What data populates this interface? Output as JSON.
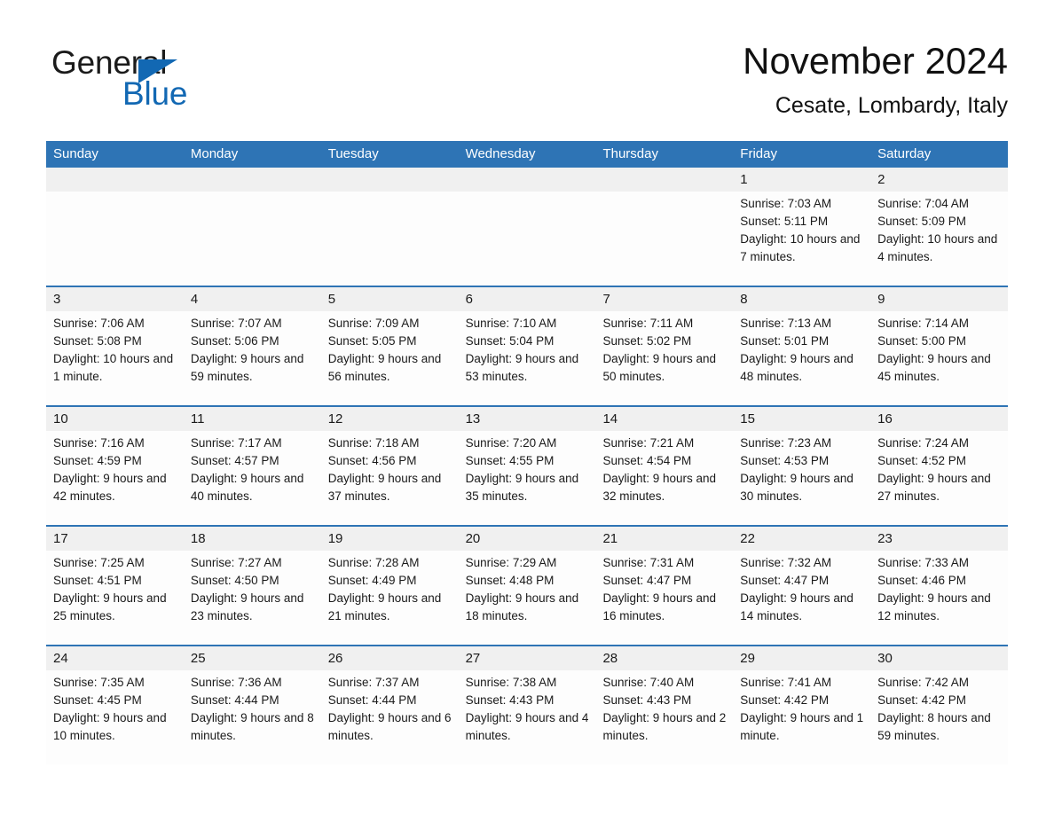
{
  "brand": {
    "name_part1": "General",
    "name_part2": "Blue",
    "accent_color": "#1268b3"
  },
  "header": {
    "month_title": "November 2024",
    "location": "Cesate, Lombardy, Italy",
    "header_bg_color": "#2e74b5"
  },
  "weekdays": [
    "Sunday",
    "Monday",
    "Tuesday",
    "Wednesday",
    "Thursday",
    "Friday",
    "Saturday"
  ],
  "weeks": [
    [
      {
        "day": "",
        "sunrise": "",
        "sunset": "",
        "daylight": "",
        "empty": true
      },
      {
        "day": "",
        "sunrise": "",
        "sunset": "",
        "daylight": "",
        "empty": true
      },
      {
        "day": "",
        "sunrise": "",
        "sunset": "",
        "daylight": "",
        "empty": true
      },
      {
        "day": "",
        "sunrise": "",
        "sunset": "",
        "daylight": "",
        "empty": true
      },
      {
        "day": "",
        "sunrise": "",
        "sunset": "",
        "daylight": "",
        "empty": true
      },
      {
        "day": "1",
        "sunrise": "Sunrise: 7:03 AM",
        "sunset": "Sunset: 5:11 PM",
        "daylight": "Daylight: 10 hours and 7 minutes."
      },
      {
        "day": "2",
        "sunrise": "Sunrise: 7:04 AM",
        "sunset": "Sunset: 5:09 PM",
        "daylight": "Daylight: 10 hours and 4 minutes."
      }
    ],
    [
      {
        "day": "3",
        "sunrise": "Sunrise: 7:06 AM",
        "sunset": "Sunset: 5:08 PM",
        "daylight": "Daylight: 10 hours and 1 minute."
      },
      {
        "day": "4",
        "sunrise": "Sunrise: 7:07 AM",
        "sunset": "Sunset: 5:06 PM",
        "daylight": "Daylight: 9 hours and 59 minutes."
      },
      {
        "day": "5",
        "sunrise": "Sunrise: 7:09 AM",
        "sunset": "Sunset: 5:05 PM",
        "daylight": "Daylight: 9 hours and 56 minutes."
      },
      {
        "day": "6",
        "sunrise": "Sunrise: 7:10 AM",
        "sunset": "Sunset: 5:04 PM",
        "daylight": "Daylight: 9 hours and 53 minutes."
      },
      {
        "day": "7",
        "sunrise": "Sunrise: 7:11 AM",
        "sunset": "Sunset: 5:02 PM",
        "daylight": "Daylight: 9 hours and 50 minutes."
      },
      {
        "day": "8",
        "sunrise": "Sunrise: 7:13 AM",
        "sunset": "Sunset: 5:01 PM",
        "daylight": "Daylight: 9 hours and 48 minutes."
      },
      {
        "day": "9",
        "sunrise": "Sunrise: 7:14 AM",
        "sunset": "Sunset: 5:00 PM",
        "daylight": "Daylight: 9 hours and 45 minutes."
      }
    ],
    [
      {
        "day": "10",
        "sunrise": "Sunrise: 7:16 AM",
        "sunset": "Sunset: 4:59 PM",
        "daylight": "Daylight: 9 hours and 42 minutes."
      },
      {
        "day": "11",
        "sunrise": "Sunrise: 7:17 AM",
        "sunset": "Sunset: 4:57 PM",
        "daylight": "Daylight: 9 hours and 40 minutes."
      },
      {
        "day": "12",
        "sunrise": "Sunrise: 7:18 AM",
        "sunset": "Sunset: 4:56 PM",
        "daylight": "Daylight: 9 hours and 37 minutes."
      },
      {
        "day": "13",
        "sunrise": "Sunrise: 7:20 AM",
        "sunset": "Sunset: 4:55 PM",
        "daylight": "Daylight: 9 hours and 35 minutes."
      },
      {
        "day": "14",
        "sunrise": "Sunrise: 7:21 AM",
        "sunset": "Sunset: 4:54 PM",
        "daylight": "Daylight: 9 hours and 32 minutes."
      },
      {
        "day": "15",
        "sunrise": "Sunrise: 7:23 AM",
        "sunset": "Sunset: 4:53 PM",
        "daylight": "Daylight: 9 hours and 30 minutes."
      },
      {
        "day": "16",
        "sunrise": "Sunrise: 7:24 AM",
        "sunset": "Sunset: 4:52 PM",
        "daylight": "Daylight: 9 hours and 27 minutes."
      }
    ],
    [
      {
        "day": "17",
        "sunrise": "Sunrise: 7:25 AM",
        "sunset": "Sunset: 4:51 PM",
        "daylight": "Daylight: 9 hours and 25 minutes."
      },
      {
        "day": "18",
        "sunrise": "Sunrise: 7:27 AM",
        "sunset": "Sunset: 4:50 PM",
        "daylight": "Daylight: 9 hours and 23 minutes."
      },
      {
        "day": "19",
        "sunrise": "Sunrise: 7:28 AM",
        "sunset": "Sunset: 4:49 PM",
        "daylight": "Daylight: 9 hours and 21 minutes."
      },
      {
        "day": "20",
        "sunrise": "Sunrise: 7:29 AM",
        "sunset": "Sunset: 4:48 PM",
        "daylight": "Daylight: 9 hours and 18 minutes."
      },
      {
        "day": "21",
        "sunrise": "Sunrise: 7:31 AM",
        "sunset": "Sunset: 4:47 PM",
        "daylight": "Daylight: 9 hours and 16 minutes."
      },
      {
        "day": "22",
        "sunrise": "Sunrise: 7:32 AM",
        "sunset": "Sunset: 4:47 PM",
        "daylight": "Daylight: 9 hours and 14 minutes."
      },
      {
        "day": "23",
        "sunrise": "Sunrise: 7:33 AM",
        "sunset": "Sunset: 4:46 PM",
        "daylight": "Daylight: 9 hours and 12 minutes."
      }
    ],
    [
      {
        "day": "24",
        "sunrise": "Sunrise: 7:35 AM",
        "sunset": "Sunset: 4:45 PM",
        "daylight": "Daylight: 9 hours and 10 minutes."
      },
      {
        "day": "25",
        "sunrise": "Sunrise: 7:36 AM",
        "sunset": "Sunset: 4:44 PM",
        "daylight": "Daylight: 9 hours and 8 minutes."
      },
      {
        "day": "26",
        "sunrise": "Sunrise: 7:37 AM",
        "sunset": "Sunset: 4:44 PM",
        "daylight": "Daylight: 9 hours and 6 minutes."
      },
      {
        "day": "27",
        "sunrise": "Sunrise: 7:38 AM",
        "sunset": "Sunset: 4:43 PM",
        "daylight": "Daylight: 9 hours and 4 minutes."
      },
      {
        "day": "28",
        "sunrise": "Sunrise: 7:40 AM",
        "sunset": "Sunset: 4:43 PM",
        "daylight": "Daylight: 9 hours and 2 minutes."
      },
      {
        "day": "29",
        "sunrise": "Sunrise: 7:41 AM",
        "sunset": "Sunset: 4:42 PM",
        "daylight": "Daylight: 9 hours and 1 minute."
      },
      {
        "day": "30",
        "sunrise": "Sunrise: 7:42 AM",
        "sunset": "Sunset: 4:42 PM",
        "daylight": "Daylight: 8 hours and 59 minutes."
      }
    ]
  ]
}
